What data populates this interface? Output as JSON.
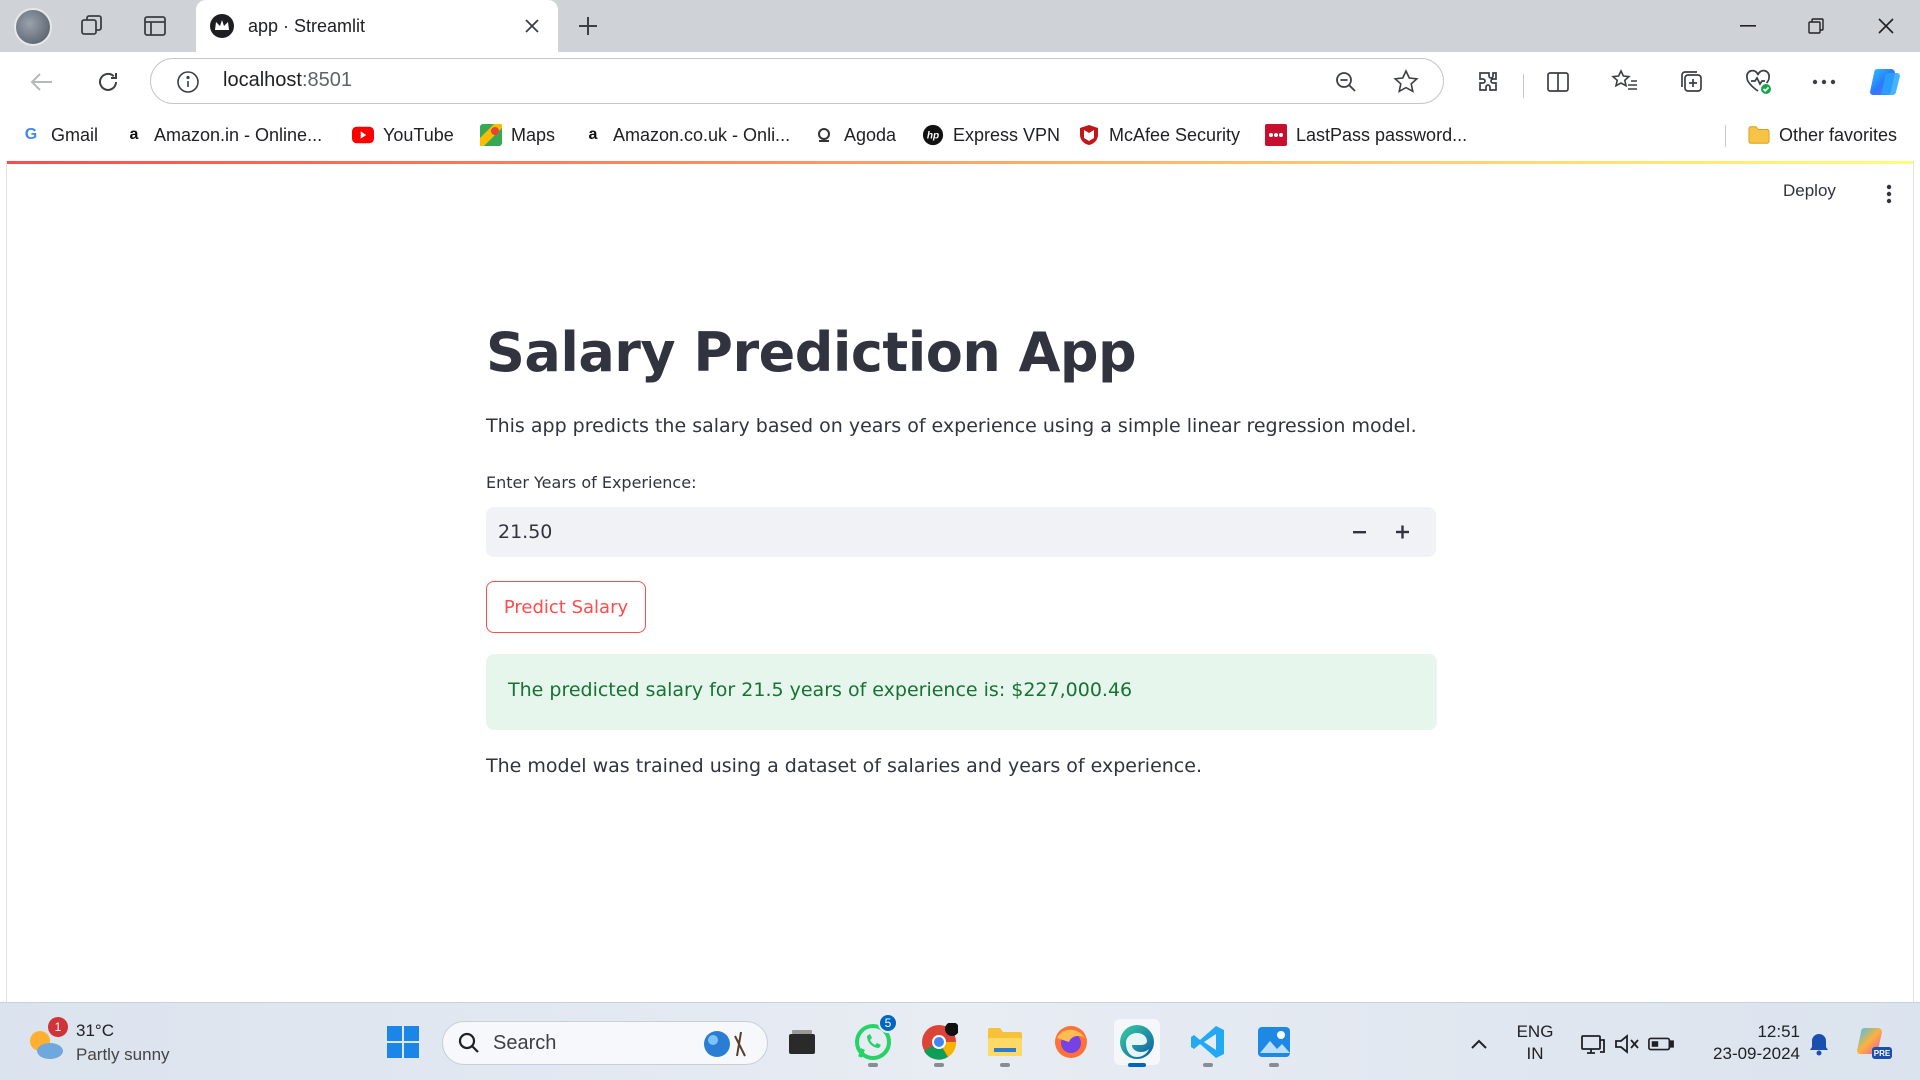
{
  "browser": {
    "tab_title": "app · Streamlit",
    "url_host": "localhost",
    "url_port": ":8501"
  },
  "bookmarks": [
    {
      "label": "Gmail",
      "icon": "google-icon"
    },
    {
      "label": "Amazon.in - Online...",
      "icon": "amazon-icon"
    },
    {
      "label": "YouTube",
      "icon": "youtube-icon"
    },
    {
      "label": "Maps",
      "icon": "maps-icon"
    },
    {
      "label": "Amazon.co.uk - Onli...",
      "icon": "amazon-icon"
    },
    {
      "label": "Agoda",
      "icon": "agoda-icon"
    },
    {
      "label": "Express VPN",
      "icon": "hp-icon"
    },
    {
      "label": "McAfee Security",
      "icon": "mcafee-icon"
    },
    {
      "label": "LastPass password...",
      "icon": "lastpass-icon"
    },
    {
      "label": "Other favorites",
      "icon": "folder-icon"
    }
  ],
  "app": {
    "deploy_label": "Deploy",
    "title": "Salary Prediction App",
    "description": "This app predicts the salary based on years of experience using a simple linear regression model.",
    "input_label": "Enter Years of Experience:",
    "input_value": "21.50",
    "button_label": "Predict Salary",
    "result_text": "The predicted salary for 21.5 years of experience is: $227,000.46",
    "footer_text": "The model was trained using a dataset of salaries and years of experience.",
    "accent_color": "#ff4b4b",
    "success_bg": "#e7f6ed",
    "success_text_color": "#177233"
  },
  "taskbar": {
    "weather_temp": "31°C",
    "weather_desc": "Partly sunny",
    "weather_badge": "1",
    "search_placeholder": "Search",
    "whatsapp_badge": "5",
    "lang_top": "ENG",
    "lang_bottom": "IN",
    "time": "12:51",
    "date": "23-09-2024"
  }
}
